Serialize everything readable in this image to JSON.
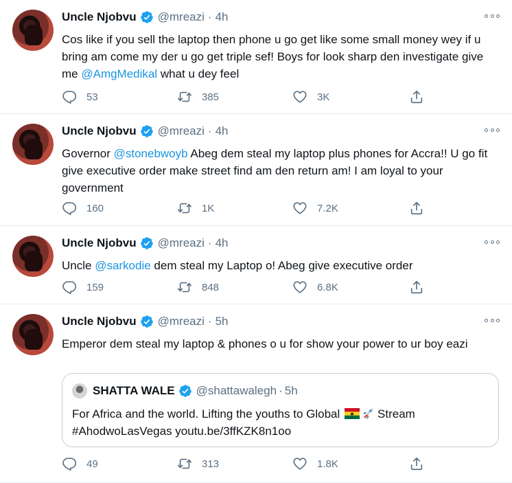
{
  "tweets": [
    {
      "name": "Uncle Njobvu",
      "handle": "@mreazi",
      "separator": "·",
      "time": "4h",
      "text_parts": [
        "Cos like if you sell the laptop then phone u go get like some small money wey if u bring am come my der u go get triple sef! Boys for look sharp den investigate give me ",
        "@AmgMedikal",
        " what u dey feel"
      ],
      "replies": "53",
      "retweets": "385",
      "likes": "3K"
    },
    {
      "name": "Uncle Njobvu",
      "handle": "@mreazi",
      "separator": "·",
      "time": "4h",
      "text_parts": [
        "Governor ",
        "@stonebwoyb",
        " Abeg dem steal my laptop plus phones for Accra!! U go fit give executive order make street find am den return am! I am loyal to your government"
      ],
      "replies": "160",
      "retweets": "1K",
      "likes": "7.2K"
    },
    {
      "name": "Uncle Njobvu",
      "handle": "@mreazi",
      "separator": "·",
      "time": "4h",
      "text_parts": [
        "Uncle ",
        "@sarkodie",
        " dem steal my Laptop o! Abeg give executive order"
      ],
      "replies": "159",
      "retweets": "848",
      "likes": "6.8K"
    },
    {
      "name": "Uncle Njobvu",
      "handle": "@mreazi",
      "separator": "·",
      "time": "5h",
      "text": "Emperor dem steal my laptop & phones o u for show your power to ur boy eazi",
      "replies": "49",
      "retweets": "313",
      "likes": "1.8K",
      "quote": {
        "name": "SHATTA WALE",
        "handle": "@shattawalegh",
        "separator": "·",
        "time": "5h",
        "line1": "For Africa and the world. Lifting the youths to Global",
        "line1_after": "Stream",
        "line2": "#AhodwoLasVegas youtu.be/3ffKZK8n1oo"
      }
    }
  ],
  "colors": {
    "text": "#0f1419",
    "secondary": "#5b7083",
    "link": "#1b95e0",
    "verified": "#1da1f2",
    "divider": "#e6ecf0"
  },
  "icons": {
    "reply": "reply-icon",
    "retweet": "retweet-icon",
    "like": "like-icon",
    "share": "share-icon",
    "verified": "verified-badge-icon",
    "more": "more-options-icon"
  }
}
